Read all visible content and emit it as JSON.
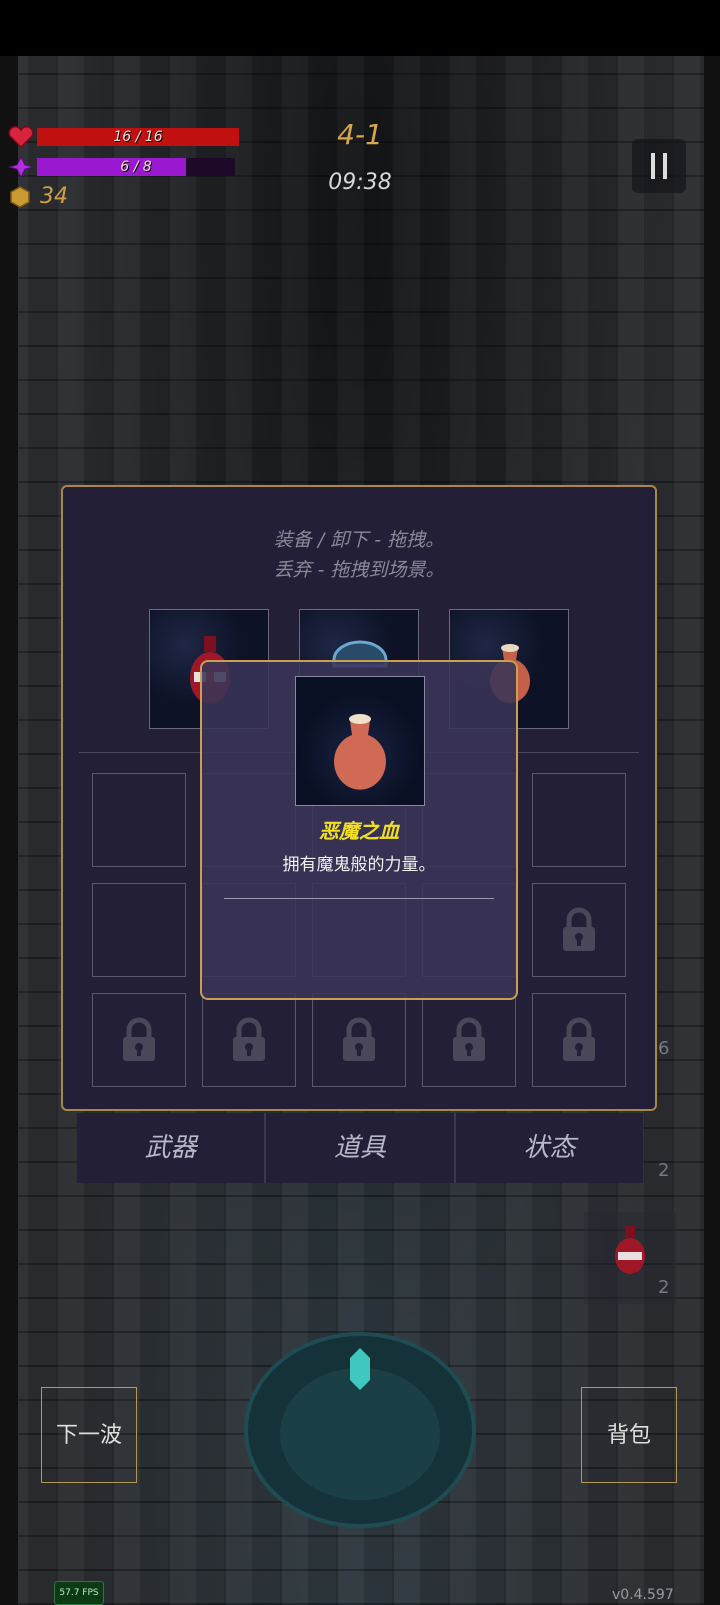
{
  "hud": {
    "hp_text": "16 / 16",
    "hp_fraction": 1.0,
    "mp_text": "6 / 8",
    "mp_fraction": 0.75,
    "gold": "34",
    "stage": "4-1",
    "timer": "09:38"
  },
  "inventory": {
    "hint_line1": "装备 / 卸下 - 拖拽。",
    "hint_line2": "丢弃 - 拖拽到场景。",
    "tabs": [
      "武器",
      "道具",
      "状态"
    ]
  },
  "tooltip": {
    "item_name": "恶魔之血",
    "item_desc": "拥有魔鬼般的力量。"
  },
  "buttons": {
    "next_wave": "下一波",
    "backpack": "背包"
  },
  "side_counts": [
    "6",
    "2",
    "2"
  ],
  "fps": "57.7 FPS",
  "version": "v0.4.597",
  "colors": {
    "hp": "#c01010",
    "mp": "#9a18d0",
    "panel_border": "#a88848",
    "tooltip_name": "#f2e020"
  }
}
